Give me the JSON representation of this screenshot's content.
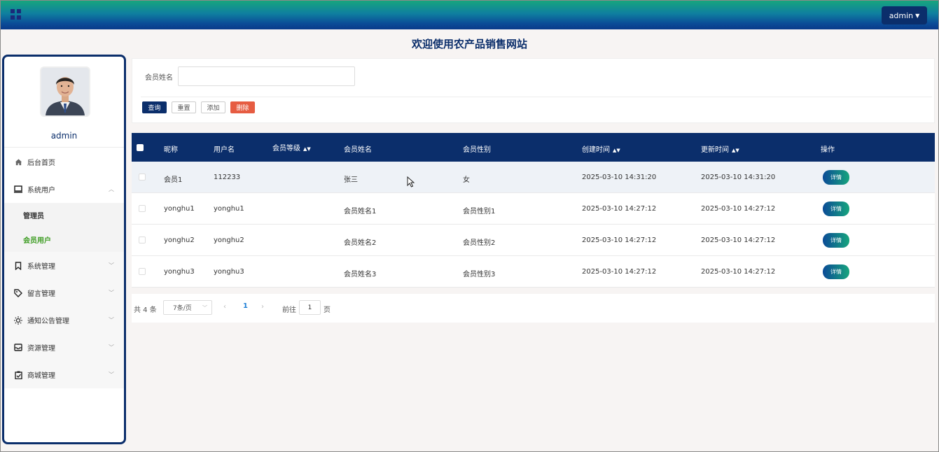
{
  "header": {
    "user_button": "admin",
    "icons": {
      "app_menu": "grid-icon",
      "dropdown": "chevron-down-icon"
    },
    "colors": {
      "bar_start": "#17a57d",
      "bar_end": "#0a3a8a",
      "brand_dark": "#0b2e6b"
    }
  },
  "page_title": "欢迎使用农产品销售网站",
  "sidebar": {
    "username": "admin",
    "menu": [
      {
        "label": "后台首页",
        "icon": "home-icon"
      },
      {
        "label": "系统用户",
        "icon": "monitor-icon",
        "expanded": true
      },
      {
        "label": "管理员",
        "sub": true
      },
      {
        "label": "会员用户",
        "sub": true,
        "active": true
      },
      {
        "label": "系统管理",
        "icon": "bookmark-icon"
      },
      {
        "label": "留言管理",
        "icon": "tag-icon"
      },
      {
        "label": "通知公告管理",
        "icon": "sun-icon"
      },
      {
        "label": "资源管理",
        "icon": "inbox-icon"
      },
      {
        "label": "商城管理",
        "icon": "clipboard-check-icon"
      }
    ]
  },
  "search": {
    "label": "会员姓名",
    "value": "",
    "buttons": {
      "query": "查询",
      "reset": "重置",
      "add": "添加",
      "delete": "删除"
    }
  },
  "table": {
    "columns": [
      "昵称",
      "用户名",
      "会员等级",
      "会员姓名",
      "会员性别",
      "创建时间",
      "更新时间",
      "操作"
    ],
    "rows": [
      {
        "nickname": "会员1",
        "username": "112233",
        "level": "",
        "name": "张三",
        "gender": "女",
        "created": "2025-03-10 14:31:20",
        "updated": "2025-03-10 14:31:20",
        "action": "详情"
      },
      {
        "nickname": "yonghu1",
        "username": "yonghu1",
        "level": "",
        "name": "会员姓名1",
        "gender": "会员性别1",
        "created": "2025-03-10 14:27:12",
        "updated": "2025-03-10 14:27:12",
        "action": "详情"
      },
      {
        "nickname": "yonghu2",
        "username": "yonghu2",
        "level": "",
        "name": "会员姓名2",
        "gender": "会员性别2",
        "created": "2025-03-10 14:27:12",
        "updated": "2025-03-10 14:27:12",
        "action": "详情"
      },
      {
        "nickname": "yonghu3",
        "username": "yonghu3",
        "level": "",
        "name": "会员姓名3",
        "gender": "会员性别3",
        "created": "2025-03-10 14:27:12",
        "updated": "2025-03-10 14:27:12",
        "action": "详情"
      }
    ]
  },
  "pagination": {
    "total": "共 4 条",
    "page_size": "7条/页",
    "current_page": "1",
    "goto_prefix": "前往",
    "goto_value": "1",
    "goto_suffix": "页"
  }
}
